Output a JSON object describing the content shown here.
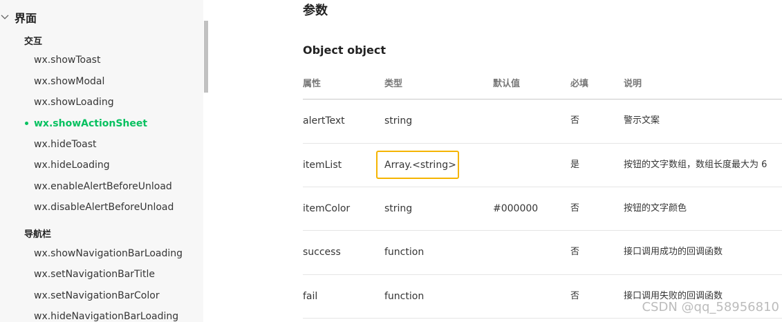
{
  "sidebar": {
    "section_label": "界面",
    "groups": [
      {
        "label": "交互",
        "items": [
          {
            "label": "wx.showToast",
            "active": false
          },
          {
            "label": "wx.showModal",
            "active": false
          },
          {
            "label": "wx.showLoading",
            "active": false
          },
          {
            "label": "wx.showActionSheet",
            "active": true
          },
          {
            "label": "wx.hideToast",
            "active": false
          },
          {
            "label": "wx.hideLoading",
            "active": false
          },
          {
            "label": "wx.enableAlertBeforeUnload",
            "active": false
          },
          {
            "label": "wx.disableAlertBeforeUnload",
            "active": false
          }
        ]
      },
      {
        "label": "导航栏",
        "items": [
          {
            "label": "wx.showNavigationBarLoading",
            "active": false
          },
          {
            "label": "wx.setNavigationBarTitle",
            "active": false
          },
          {
            "label": "wx.setNavigationBarColor",
            "active": false
          },
          {
            "label": "wx.hideNavigationBarLoading",
            "active": false
          }
        ]
      }
    ]
  },
  "main": {
    "heading": "参数",
    "subheading": "Object object",
    "table": {
      "headers": [
        "属性",
        "类型",
        "默认值",
        "必填",
        "说明"
      ],
      "rows": [
        [
          "alertText",
          "string",
          "",
          "否",
          "警示文案"
        ],
        [
          "itemList",
          "Array.<string>",
          "",
          "是",
          "按钮的文字数组，数组长度最大为 6"
        ],
        [
          "itemColor",
          "string",
          "#000000",
          "否",
          "按钮的文字颜色"
        ],
        [
          "success",
          "function",
          "",
          "否",
          "接口调用成功的回调函数"
        ],
        [
          "fail",
          "function",
          "",
          "否",
          "接口调用失败的回调函数"
        ]
      ]
    }
  },
  "watermark": "CSDN @qq_58956810",
  "colors": {
    "accent": "#07c160",
    "highlight_border": "#f5b400",
    "sidebar_bg": "#f7f7f7"
  }
}
